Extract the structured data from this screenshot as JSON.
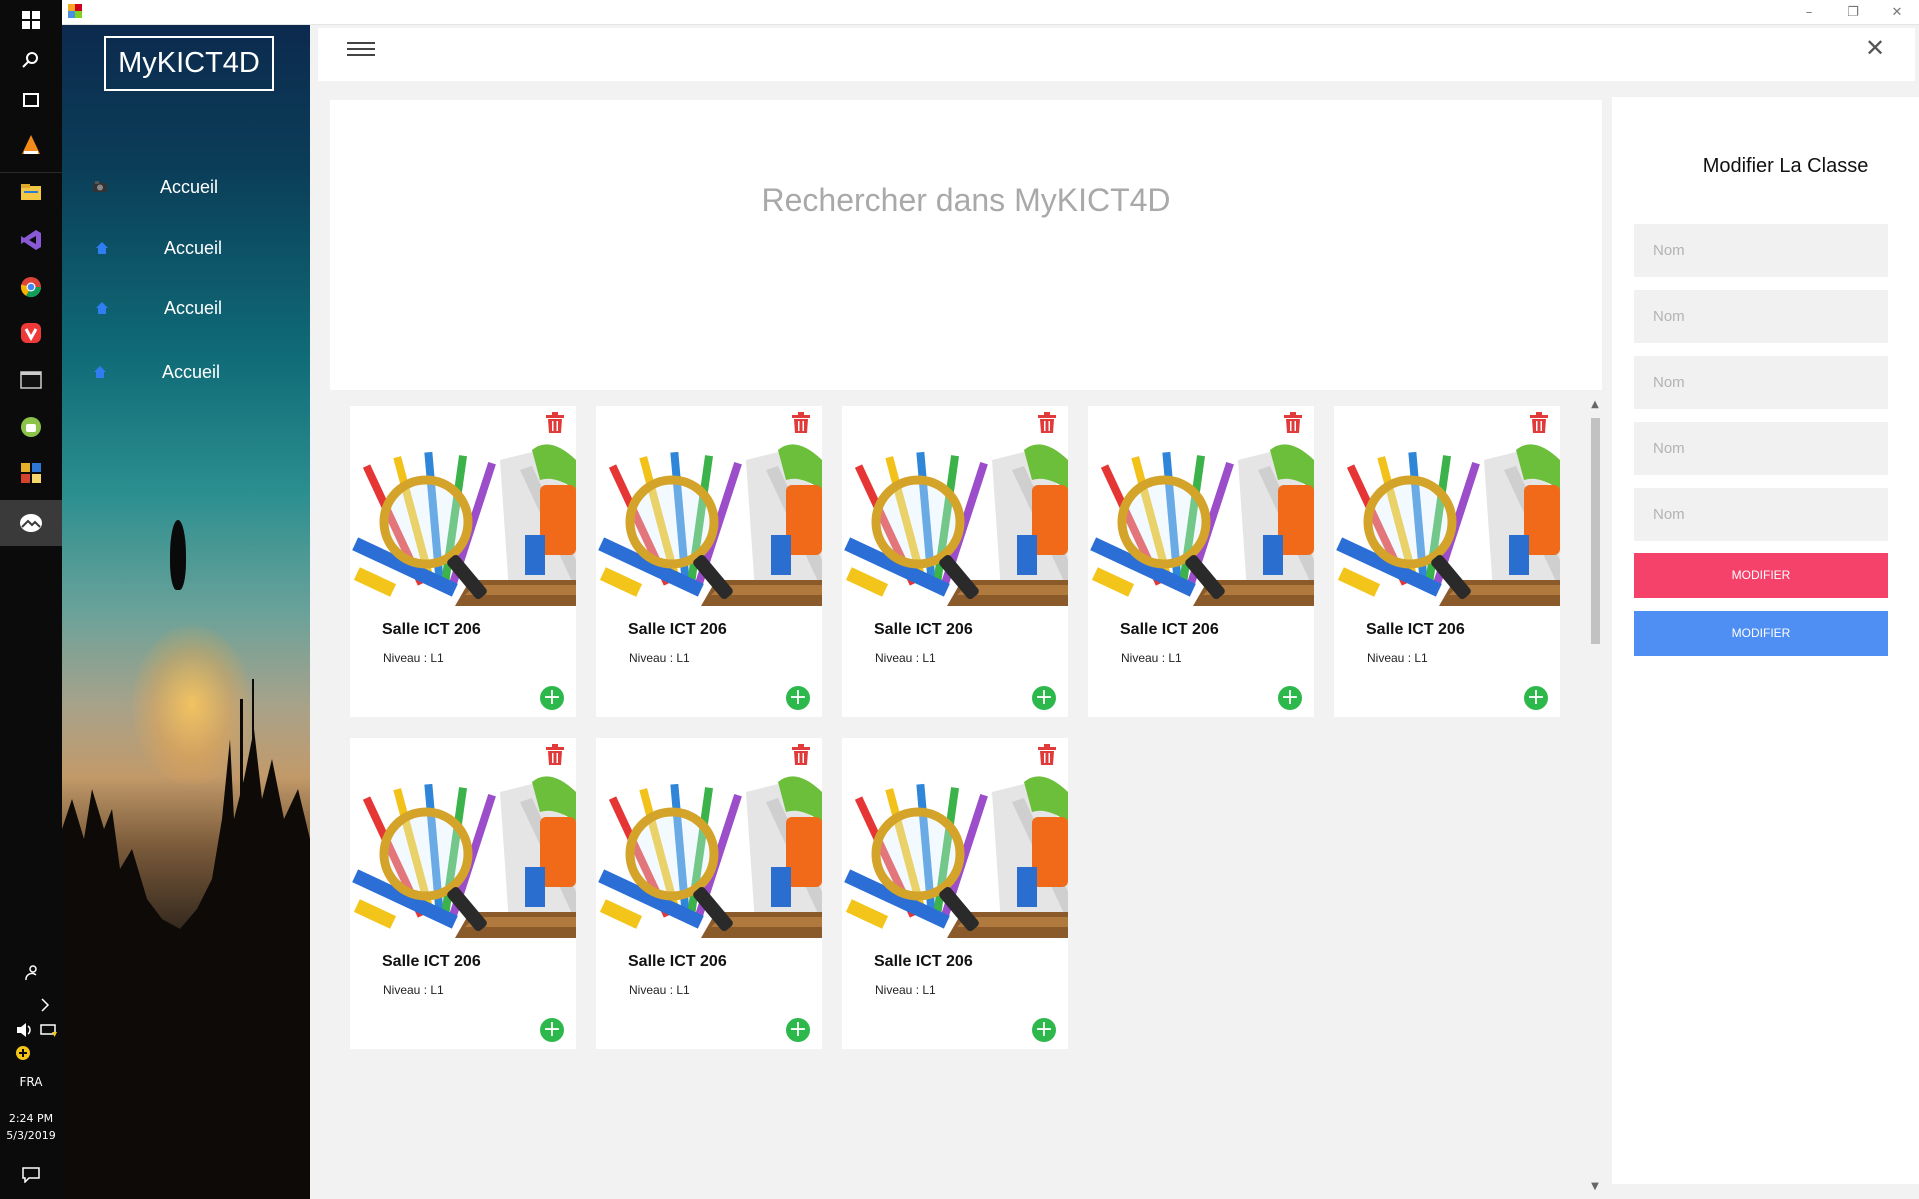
{
  "app": {
    "logo": "MyKICT4D"
  },
  "sidebar": {
    "items": [
      {
        "label": "Accueil",
        "icon": "app-icon"
      },
      {
        "label": "Accueil",
        "icon": "home-icon"
      },
      {
        "label": "Accueil",
        "icon": "home-icon"
      },
      {
        "label": "Accueil",
        "icon": "home-icon"
      }
    ]
  },
  "search": {
    "placeholder": "Rechercher dans MyKICT4D"
  },
  "cards": [
    {
      "title": "Salle ICT 206",
      "level_label": "Niveau :",
      "level": "L1"
    },
    {
      "title": "Salle ICT 206",
      "level_label": "Niveau :",
      "level": "L1"
    },
    {
      "title": "Salle ICT 206",
      "level_label": "Niveau :",
      "level": "L1"
    },
    {
      "title": "Salle ICT 206",
      "level_label": "Niveau :",
      "level": "L1"
    },
    {
      "title": "Salle ICT 206",
      "level_label": "Niveau :",
      "level": "L1"
    },
    {
      "title": "Salle ICT 206",
      "level_label": "Niveau :",
      "level": "L1"
    },
    {
      "title": "Salle ICT 206",
      "level_label": "Niveau :",
      "level": "L1"
    },
    {
      "title": "Salle ICT 206",
      "level_label": "Niveau :",
      "level": "L1"
    }
  ],
  "form": {
    "title": "Modifier La Classe",
    "fields": [
      {
        "placeholder": "Nom"
      },
      {
        "placeholder": "Nom"
      },
      {
        "placeholder": "Nom"
      },
      {
        "placeholder": "Nom"
      },
      {
        "placeholder": "Nom"
      }
    ],
    "buttons": [
      {
        "label": "MODIFIER",
        "color": "#f5426a"
      },
      {
        "label": "MODIFIER",
        "color": "#4f8ef2"
      }
    ]
  },
  "taskbar": {
    "language": "FRA",
    "time": "2:24 PM",
    "date": "5/3/2019"
  },
  "colors": {
    "accent_pink": "#f5426a",
    "accent_blue": "#4f8ef2",
    "add_green": "#2db84c",
    "trash_red": "#e03a3a"
  }
}
